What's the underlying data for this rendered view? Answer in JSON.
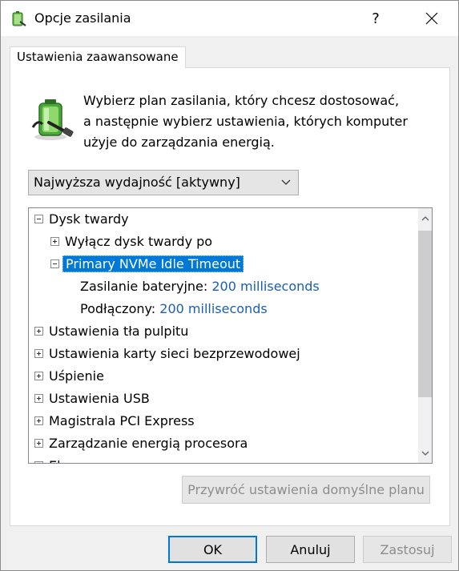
{
  "window": {
    "title": "Opcje zasilania",
    "help_label": "?",
    "close_icon": "close-icon"
  },
  "tab": {
    "label": "Ustawienia zaawansowane"
  },
  "description": {
    "line1": "Wybierz plan zasilania, który chcesz dostosować,",
    "line2": "a następnie wybierz ustawienia, których komputer",
    "line3": "użyje do zarządzania energią."
  },
  "plan_select": {
    "value": "Najwyższa wydajność [aktywny]"
  },
  "tree": {
    "items": [
      {
        "label": "Dysk twardy",
        "state": "expanded"
      },
      {
        "label": "Wyłącz dysk twardy po",
        "state": "collapsed"
      },
      {
        "label": "Primary NVMe Idle Timeout",
        "state": "expanded",
        "selected": true
      },
      {
        "label": "Zasilanie bateryjne:",
        "value": "200 milliseconds"
      },
      {
        "label": "Podłączony:",
        "value": "200 milliseconds"
      },
      {
        "label": "Ustawienia tła pulpitu",
        "state": "collapsed"
      },
      {
        "label": "Ustawienia karty sieci bezprzewodowej",
        "state": "collapsed"
      },
      {
        "label": "Uśpienie",
        "state": "collapsed"
      },
      {
        "label": "Ustawienia USB",
        "state": "collapsed"
      },
      {
        "label": "Magistrala PCI Express",
        "state": "collapsed"
      },
      {
        "label": "Zarządzanie energią procesora",
        "state": "collapsed"
      },
      {
        "label": "Ek",
        "state": "collapsed"
      }
    ]
  },
  "restore_button": {
    "label": "Przywróć ustawienia domyślne planu"
  },
  "buttons": {
    "ok": "OK",
    "cancel": "Anuluj",
    "apply": "Zastosuj"
  },
  "colors": {
    "selection": "#0078d7",
    "link": "#1a5fb4"
  }
}
